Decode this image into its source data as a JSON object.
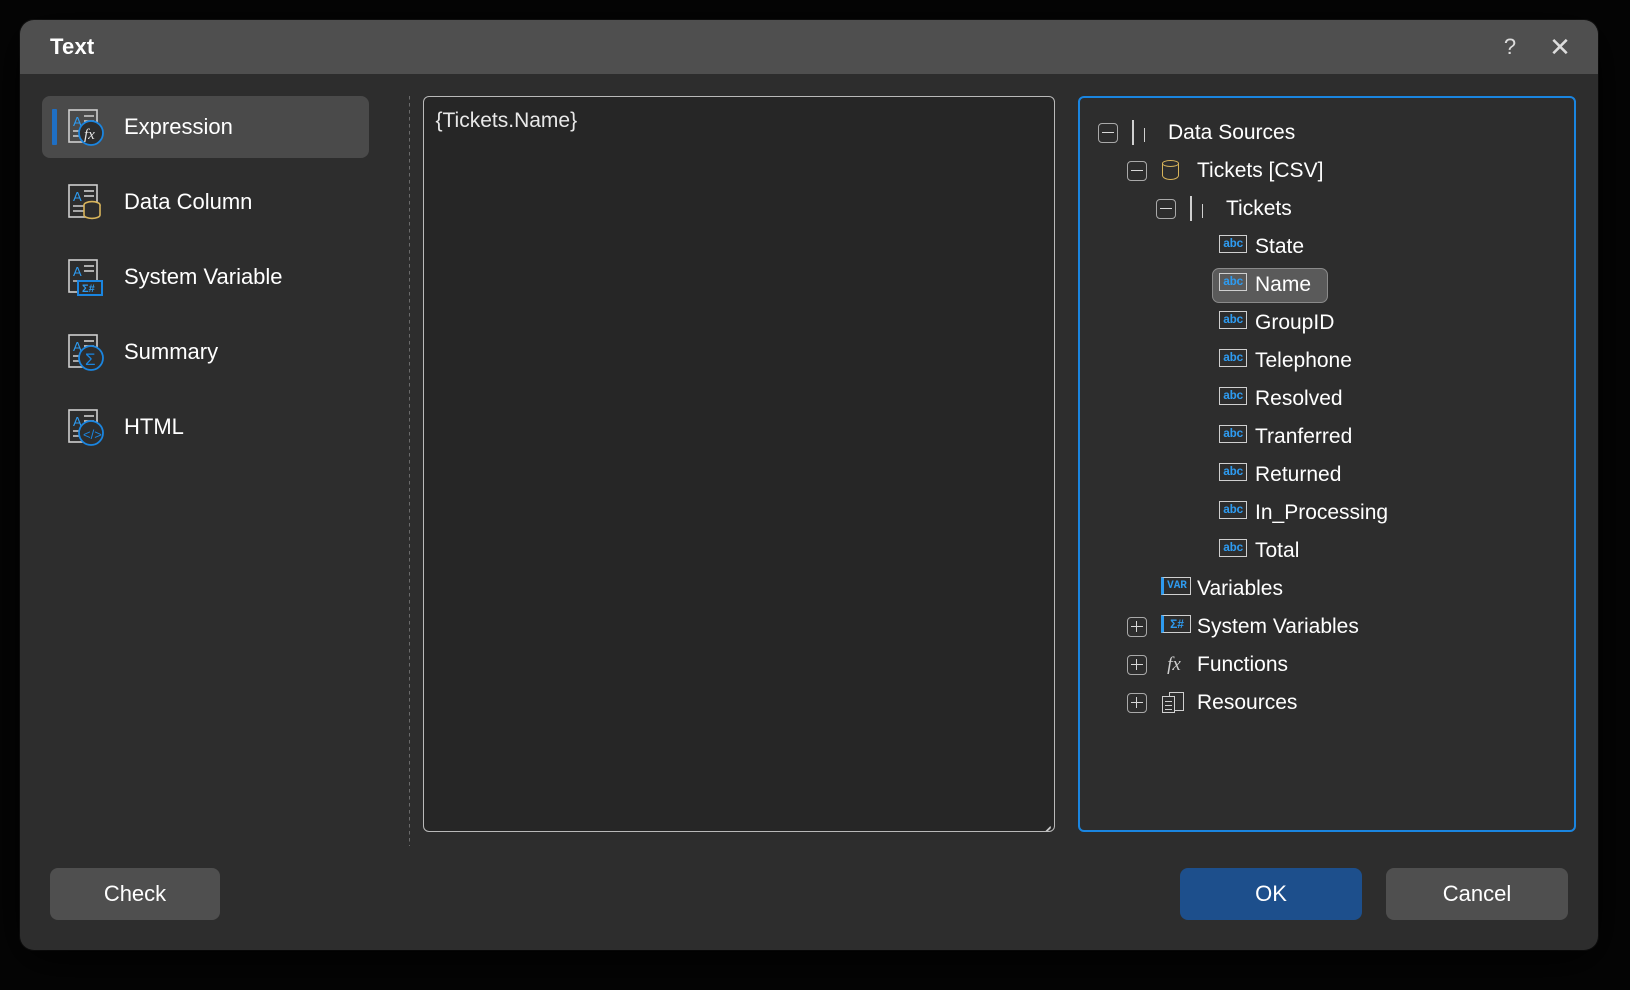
{
  "window": {
    "title": "Text",
    "help_label": "?",
    "close_label": "✕",
    "accent_color": "#1a85e0",
    "titlebar_color": "#4f4f4f",
    "body_color": "#2d2d2d"
  },
  "sidebar": {
    "items": [
      {
        "label": "Expression",
        "icon": "expression-fx-icon",
        "selected": true
      },
      {
        "label": "Data Column",
        "icon": "data-column-icon",
        "selected": false
      },
      {
        "label": "System Variable",
        "icon": "system-variable-icon",
        "selected": false
      },
      {
        "label": "Summary",
        "icon": "summary-sigma-icon",
        "selected": false
      },
      {
        "label": "HTML",
        "icon": "html-code-icon",
        "selected": false
      }
    ]
  },
  "editor": {
    "value": "{Tickets.Name}",
    "placeholder": ""
  },
  "tree": {
    "nodes": [
      {
        "label": "Data Sources",
        "icon": "grid-icon",
        "indent": 0,
        "expander": "minus",
        "selected": false
      },
      {
        "label": "Tickets [CSV]",
        "icon": "database-icon",
        "indent": 1,
        "expander": "minus",
        "selected": false
      },
      {
        "label": "Tickets",
        "icon": "grid-icon",
        "indent": 2,
        "expander": "minus",
        "selected": false
      },
      {
        "label": "State",
        "icon": "abc-icon",
        "indent": 3,
        "expander": "none",
        "selected": false
      },
      {
        "label": "Name",
        "icon": "abc-icon",
        "indent": 3,
        "expander": "none",
        "selected": true
      },
      {
        "label": "GroupID",
        "icon": "abc-icon",
        "indent": 3,
        "expander": "none",
        "selected": false
      },
      {
        "label": "Telephone",
        "icon": "abc-icon",
        "indent": 3,
        "expander": "none",
        "selected": false
      },
      {
        "label": "Resolved",
        "icon": "abc-icon",
        "indent": 3,
        "expander": "none",
        "selected": false
      },
      {
        "label": "Tranferred",
        "icon": "abc-icon",
        "indent": 3,
        "expander": "none",
        "selected": false
      },
      {
        "label": "Returned",
        "icon": "abc-icon",
        "indent": 3,
        "expander": "none",
        "selected": false
      },
      {
        "label": "In_Processing",
        "icon": "abc-icon",
        "indent": 3,
        "expander": "none",
        "selected": false
      },
      {
        "label": "Total",
        "icon": "abc-icon",
        "indent": 3,
        "expander": "none",
        "selected": false
      },
      {
        "label": "Variables",
        "icon": "var-icon",
        "indent": 1,
        "expander": "none",
        "selected": false
      },
      {
        "label": "System Variables",
        "icon": "sigma-hash-icon",
        "indent": 1,
        "expander": "plus",
        "selected": false
      },
      {
        "label": "Functions",
        "icon": "fx-icon",
        "indent": 1,
        "expander": "plus",
        "selected": false
      },
      {
        "label": "Resources",
        "icon": "resources-icon",
        "indent": 1,
        "expander": "plus",
        "selected": false
      }
    ],
    "abc_text": "abc",
    "var_text": "VAR",
    "sigma_text": "Σ#",
    "fx_text": "fx"
  },
  "footer": {
    "check_label": "Check",
    "ok_label": "OK",
    "cancel_label": "Cancel"
  }
}
